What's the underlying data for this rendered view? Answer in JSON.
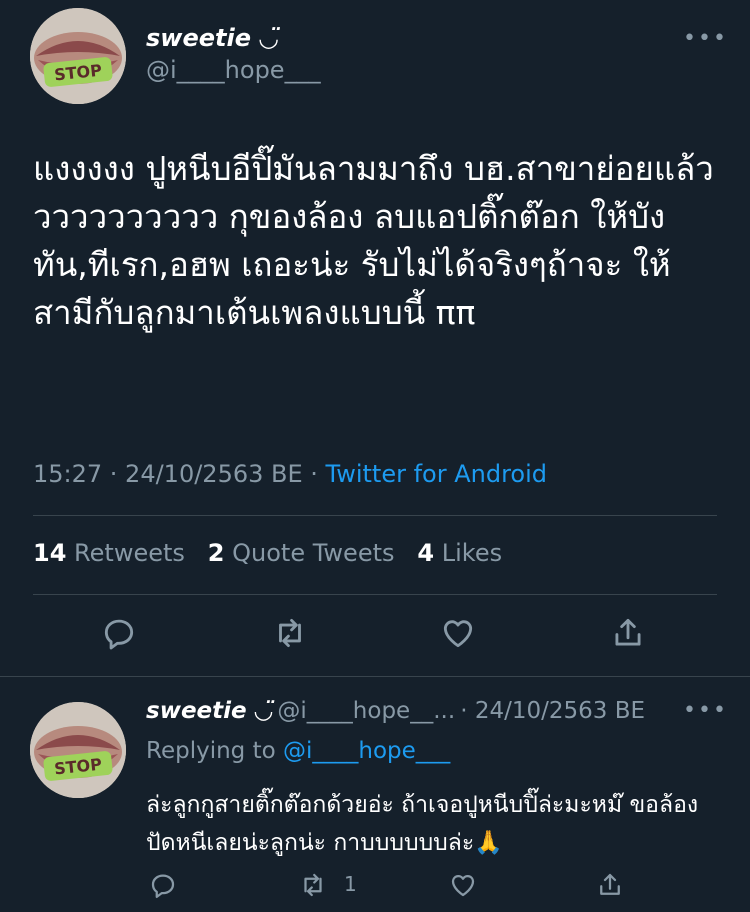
{
  "main_tweet": {
    "author_name": "sweetie ◡̈",
    "author_handle": "@i____hope___",
    "more_label": "•••",
    "text": "แงงงงง ปูหนีบอีปิ๊มันลามมาถึง บฮ.สาขาย่อยแล้ววววววววววว กุของล้อง ลบแอปติ๊กต๊อก ให้บังทัน,ทีเรก,อฮพ เถอะน่ะ รับไม่ได้จริงๆถ้าจะ ให้สามีกับลูกมาเต้นเพลงแบบนี้ ππ",
    "time": "15:27 · 24/10/2563 BE · ",
    "source": "Twitter for Android",
    "retweets_count": "14",
    "retweets_label": "Retweets",
    "quotes_count": "2",
    "quotes_label": "Quote Tweets",
    "likes_count": "4",
    "likes_label": "Likes"
  },
  "reply_tweet": {
    "author_name": "sweetie ◡̈",
    "author_handle": "@i____hope__...",
    "date": "· 24/10/2563 BE",
    "more_label": "•••",
    "replying_to_label": "Replying to ",
    "replying_to_handle": "@i____hope___",
    "text": "ล่ะลูกกูสายติ๊กต๊อกด้วยอ่ะ ถ้าเจอปูหนีบปิ๊ล่ะมะหม๊ ขอล้อง ปัดหนีเลยน่ะลูกน่ะ กาบบบบบบล่ะ🙏",
    "retweet_count": "1"
  },
  "icons": {
    "reply": "reply-icon",
    "retweet": "retweet-icon",
    "like": "heart-icon",
    "share": "share-icon"
  },
  "colors": {
    "background": "#15202b",
    "secondary_text": "#8899a6",
    "link": "#1d9bf0",
    "divider": "#38444d"
  }
}
